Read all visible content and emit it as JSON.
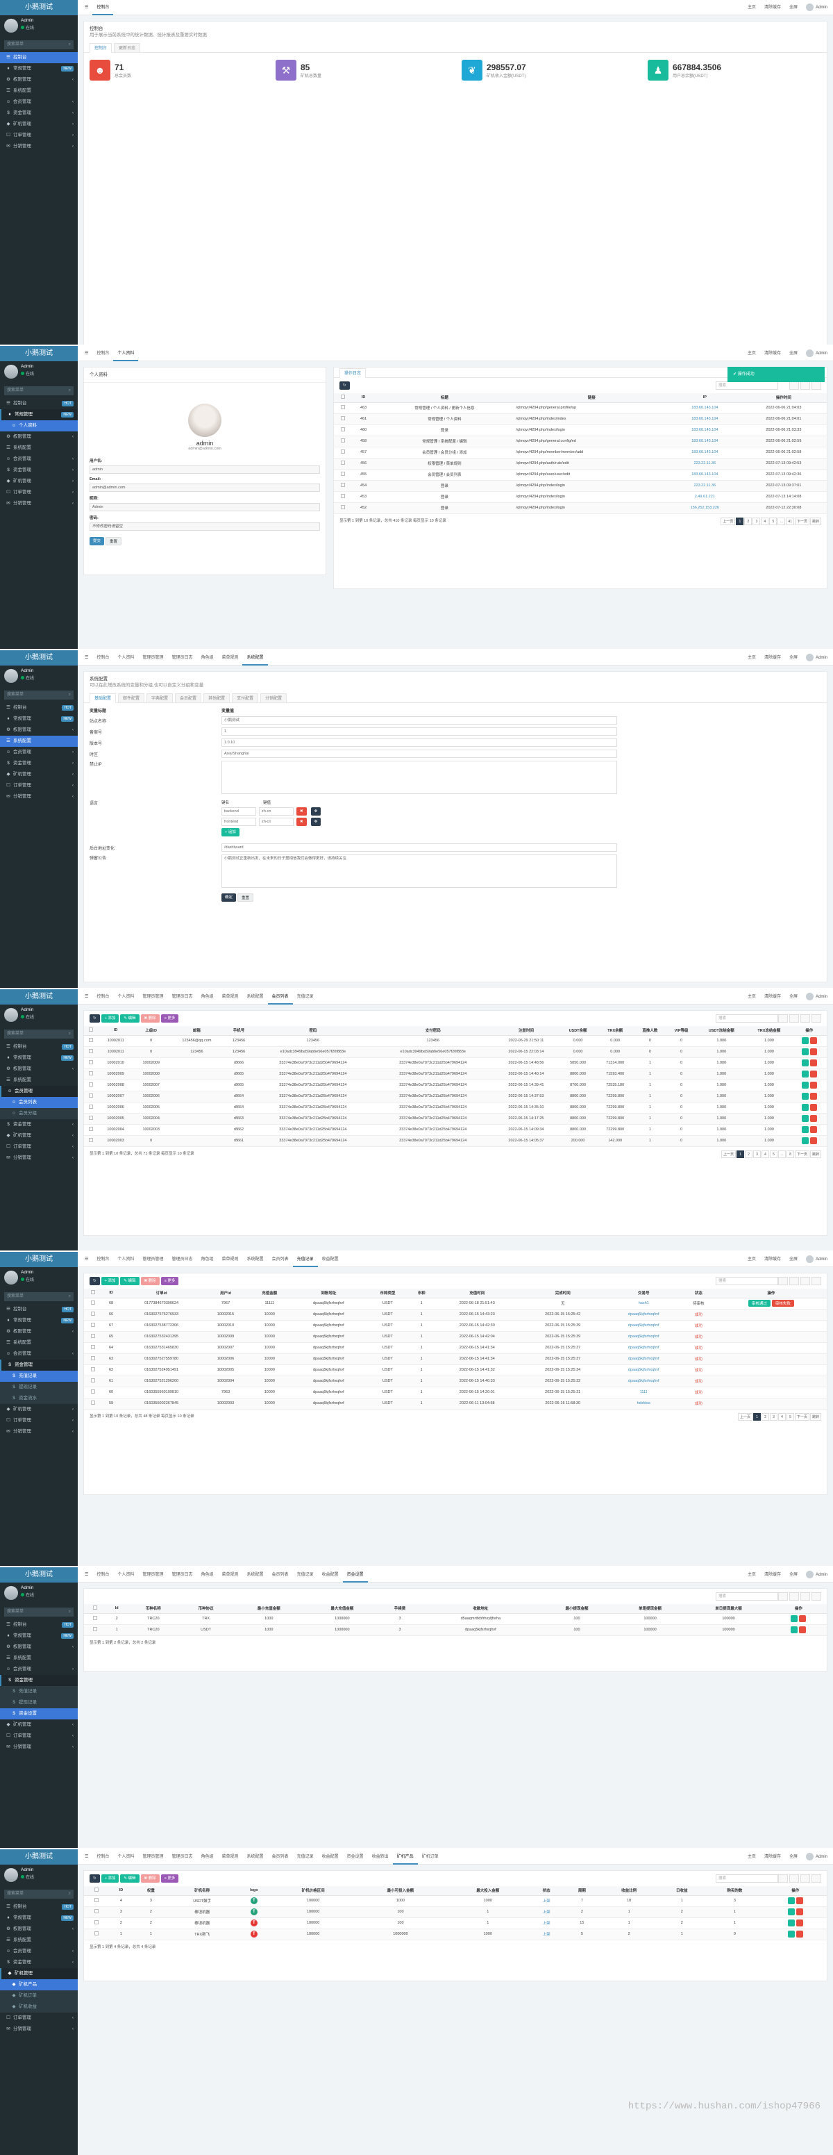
{
  "app": {
    "brand": "小鹅测试",
    "user": "Admin",
    "status": "在线",
    "search_ph": "搜索菜单",
    "admin_name": "Admin"
  },
  "top": {
    "home": "主页",
    "clear": "清除缓存",
    "fullscreen": "全屏"
  },
  "tabs": {
    "console": "控制台",
    "profile": "个人资料",
    "admin": "管理员管理",
    "logs": "管理员日志",
    "role": "角色组",
    "menu": "菜单规则",
    "config": "系统配置",
    "members": "会员列表",
    "orders": "充值记录",
    "payment": "收益配置",
    "recharge": "资金设置",
    "withdraw": "收益转出",
    "pledge": "矿机产品",
    "order2": "矿机订单"
  },
  "menu": {
    "p1": [
      {
        "ic": "☰",
        "label": "控制台",
        "act": true
      },
      {
        "ic": "♦",
        "label": "常规管理",
        "badge": "NEW"
      },
      {
        "ic": "⚙",
        "label": "权限管理",
        "ch": "‹"
      },
      {
        "ic": "☰",
        "label": "系统配置"
      },
      {
        "ic": "☺",
        "label": "会员管理",
        "ch": "‹"
      },
      {
        "ic": "$",
        "label": "资金管理",
        "ch": "‹"
      },
      {
        "ic": "◆",
        "label": "矿机管理",
        "ch": "‹"
      },
      {
        "ic": "☐",
        "label": "订单管理",
        "ch": "‹"
      },
      {
        "ic": "✉",
        "label": "分销管理",
        "ch": "‹"
      }
    ],
    "p2": [
      {
        "ic": "☰",
        "label": "控制台",
        "badge": "HOT"
      },
      {
        "ic": "♦",
        "label": "常规管理",
        "badge": "NEW",
        "open": true
      },
      {
        "ic": "☺",
        "label": "个人资料",
        "subact": true
      },
      {
        "ic": "⚙",
        "label": "权限管理",
        "ch": "‹"
      },
      {
        "ic": "☰",
        "label": "系统配置"
      },
      {
        "ic": "☺",
        "label": "会员管理",
        "ch": "‹"
      },
      {
        "ic": "$",
        "label": "资金管理",
        "ch": "‹"
      },
      {
        "ic": "◆",
        "label": "矿机管理",
        "ch": "‹"
      },
      {
        "ic": "☐",
        "label": "订单管理",
        "ch": "‹"
      },
      {
        "ic": "✉",
        "label": "分销管理",
        "ch": "‹"
      }
    ],
    "p3": [
      {
        "ic": "☰",
        "label": "控制台",
        "badge": "HOT"
      },
      {
        "ic": "♦",
        "label": "常规管理",
        "badge": "NEW"
      },
      {
        "ic": "⚙",
        "label": "权限管理",
        "ch": "‹"
      },
      {
        "ic": "☰",
        "label": "系统配置",
        "act": true
      },
      {
        "ic": "☺",
        "label": "会员管理",
        "ch": "‹"
      },
      {
        "ic": "$",
        "label": "资金管理",
        "ch": "‹"
      },
      {
        "ic": "◆",
        "label": "矿机管理",
        "ch": "‹"
      },
      {
        "ic": "☐",
        "label": "订单管理",
        "ch": "‹"
      },
      {
        "ic": "✉",
        "label": "分销管理",
        "ch": "‹"
      }
    ],
    "p4": [
      {
        "ic": "☰",
        "label": "控制台",
        "badge": "HOT"
      },
      {
        "ic": "♦",
        "label": "常规管理",
        "badge": "NEW"
      },
      {
        "ic": "⚙",
        "label": "权限管理",
        "ch": "‹"
      },
      {
        "ic": "☰",
        "label": "系统配置"
      },
      {
        "ic": "☺",
        "label": "会员管理",
        "open": true
      },
      {
        "ic": "☺",
        "label": "会员列表",
        "subact": true
      },
      {
        "ic": "☺",
        "label": "会员分组",
        "sub": true
      },
      {
        "ic": "$",
        "label": "资金管理",
        "ch": "‹"
      },
      {
        "ic": "◆",
        "label": "矿机管理",
        "ch": "‹"
      },
      {
        "ic": "☐",
        "label": "订单管理",
        "ch": "‹"
      },
      {
        "ic": "✉",
        "label": "分销管理",
        "ch": "‹"
      }
    ],
    "p5": [
      {
        "ic": "☰",
        "label": "控制台",
        "badge": "HOT"
      },
      {
        "ic": "♦",
        "label": "常规管理",
        "badge": "NEW"
      },
      {
        "ic": "⚙",
        "label": "权限管理",
        "ch": "‹"
      },
      {
        "ic": "☰",
        "label": "系统配置"
      },
      {
        "ic": "☺",
        "label": "会员管理",
        "ch": "‹"
      },
      {
        "ic": "$",
        "label": "资金管理",
        "open": true
      },
      {
        "ic": "$",
        "label": "充值记录",
        "subact": true
      },
      {
        "ic": "$",
        "label": "提现记录",
        "sub": true
      },
      {
        "ic": "$",
        "label": "资金流水",
        "sub": true
      },
      {
        "ic": "◆",
        "label": "矿机管理",
        "ch": "‹"
      },
      {
        "ic": "☐",
        "label": "订单管理",
        "ch": "‹"
      },
      {
        "ic": "✉",
        "label": "分销管理",
        "ch": "‹"
      }
    ],
    "p6": [
      {
        "ic": "☰",
        "label": "控制台",
        "badge": "HOT"
      },
      {
        "ic": "♦",
        "label": "常规管理",
        "badge": "NEW"
      },
      {
        "ic": "⚙",
        "label": "权限管理",
        "ch": "‹"
      },
      {
        "ic": "☰",
        "label": "系统配置"
      },
      {
        "ic": "☺",
        "label": "会员管理",
        "ch": "‹"
      },
      {
        "ic": "$",
        "label": "资金管理",
        "open": true
      },
      {
        "ic": "$",
        "label": "充值记录",
        "sub": true
      },
      {
        "ic": "$",
        "label": "提现记录",
        "sub": true
      },
      {
        "ic": "$",
        "label": "资金设置",
        "subact": true
      },
      {
        "ic": "◆",
        "label": "矿机管理",
        "ch": "‹"
      },
      {
        "ic": "☐",
        "label": "订单管理",
        "ch": "‹"
      },
      {
        "ic": "✉",
        "label": "分销管理",
        "ch": "‹"
      }
    ],
    "p7": [
      {
        "ic": "☰",
        "label": "控制台",
        "badge": "HOT"
      },
      {
        "ic": "♦",
        "label": "常规管理",
        "badge": "NEW"
      },
      {
        "ic": "⚙",
        "label": "权限管理",
        "ch": "‹"
      },
      {
        "ic": "☰",
        "label": "系统配置"
      },
      {
        "ic": "☺",
        "label": "会员管理",
        "ch": "‹"
      },
      {
        "ic": "$",
        "label": "资金管理",
        "ch": "‹"
      },
      {
        "ic": "◆",
        "label": "矿机管理",
        "open": true
      },
      {
        "ic": "◆",
        "label": "矿机产品",
        "subact": true
      },
      {
        "ic": "◆",
        "label": "矿机订单",
        "sub": true
      },
      {
        "ic": "◆",
        "label": "矿机收益",
        "sub": true
      },
      {
        "ic": "☐",
        "label": "订单管理",
        "ch": "‹"
      },
      {
        "ic": "✉",
        "label": "分销管理",
        "ch": "‹"
      }
    ]
  },
  "dash": {
    "title": "控制台",
    "sub": "用于展示当前系统中的统计数据、统计报表及重要实时数据",
    "tab1": "控制台",
    "tab2": "更新日志",
    "stats": [
      {
        "icon": "☻",
        "num": "71",
        "label": "总会员数",
        "color": "#e74c3c"
      },
      {
        "icon": "⚒",
        "num": "85",
        "label": "矿机总数量",
        "color": "#8e6fc9"
      },
      {
        "icon": "❦",
        "num": "298557.07",
        "label": "矿机收入金额(USDT)",
        "color": "#1fa7d5"
      },
      {
        "icon": "♟",
        "num": "667884.3506",
        "label": "用户总余额(USDT)",
        "color": "#18bc9c"
      }
    ]
  },
  "profile": {
    "box_title": "个人资料",
    "name": "admin",
    "email": "admin@admin.com",
    "fields": [
      {
        "label": "用户名:",
        "value": "admin"
      },
      {
        "label": "Email:",
        "value": "admin@admin.com"
      },
      {
        "label": "昵称:",
        "value": "Admin"
      },
      {
        "label": "密码:",
        "value": "不修改密码请留空"
      }
    ],
    "submit": "提交",
    "reset": "重置",
    "log_title": "操作日志",
    "toast": "操作成功",
    "log_cols": [
      "ID",
      "标题",
      "链接",
      "IP",
      "操作时间"
    ],
    "log_rows": [
      [
        "463",
        "常规管理 / 个人资料 / 更新个人信息",
        "/qlmqvr/4294.php/general.profile/up",
        "183.60.143.104",
        "2022-06-06 21:04:03"
      ],
      [
        "461",
        "常规管理 / 个人资料",
        "/qlmqvr/4294.php/index/index",
        "183.60.143.104",
        "2022-06-06 21:04:01"
      ],
      [
        "460",
        "登录",
        "/qlmqvr/4294.php/index/login",
        "183.60.143.104",
        "2022-06-06 21:03:33"
      ],
      [
        "458",
        "常规管理 / 系统配置 / 编辑",
        "/qlmqvr/4294.php/general.config/ed",
        "183.60.143.104",
        "2022-06-06 21:02:59"
      ],
      [
        "457",
        "会员管理 / 会员分组 / 添加",
        "/qlmqvr/4294.php/member/member/add",
        "183.60.143.104",
        "2022-06-06 21:02:58"
      ],
      [
        "456",
        "权限管理 / 菜单规则",
        "/qlmqvr/4294.php/auth/rule/edit",
        "223.22.11.36",
        "2022-07-13 09:42:53"
      ],
      [
        "455",
        "会员管理 / 会员列表",
        "/qlmqvr/4294.php/user/user/edit",
        "183.60.143.104",
        "2022-07-13 09:42:36"
      ],
      [
        "454",
        "登录",
        "/qlmqvr/4294.php/index/login",
        "223.22.11.36",
        "2022-07-13 09:37:01"
      ],
      [
        "453",
        "登录",
        "/qlmqvr/4294.php/index/login",
        "2.49.61.221",
        "2022-07-13 14:14:08"
      ],
      [
        "452",
        "登录",
        "/qlmqvr/4294.php/index/login",
        "156.252.153.226",
        "2022-07-12 22:30:08"
      ]
    ],
    "pager": "显示第 1 到第 10 条记录，总共 410 条记录 每页显示 10 条记录",
    "pages": [
      "上一页",
      "1",
      "2",
      "3",
      "4",
      "5",
      "...",
      "41",
      "下一页"
    ],
    "goto": "跳转"
  },
  "config": {
    "title": "系统配置",
    "sub": "可以在此增改系统的变量和分组,也可以自定义分组和变量",
    "tabs": [
      "基础配置",
      "邮件配置",
      "字典配置",
      "会员配置",
      "其他配置",
      "支付配置",
      "分销配置"
    ],
    "col1": "变量标题",
    "col2": "变量值",
    "rows": [
      {
        "label": "站点名称",
        "value": "小鹅测试"
      },
      {
        "label": "备案号",
        "value": "1"
      },
      {
        "label": "版本号",
        "value": "1.0.10"
      },
      {
        "label": "时区",
        "value": "Asia/Shanghai"
      },
      {
        "label": "禁止IP",
        "value": ""
      }
    ],
    "lang_label": "语言",
    "lang_head1": "键名",
    "lang_head2": "键值",
    "langs": [
      {
        "k": "backend",
        "v": "zh-cn"
      },
      {
        "k": "frontend",
        "v": "zh-cn"
      }
    ],
    "append": "追加",
    "addr_label": "后台地址变化",
    "addr_value": "/dashboard",
    "notice_label": "弹窗公告",
    "notice_value": "小鹅测试正重新出发，在未来的日子里相信我们会做得更好，请持续关注",
    "ok": "确定",
    "reset": "重置"
  },
  "members": {
    "cols": [
      "ID",
      "上级ID",
      "邮箱",
      "手机号",
      "密码",
      "支付密码",
      "注册时间",
      "USDT余额",
      "TRX余额",
      "直推人数",
      "VIP等级",
      "USDT冻结金额",
      "TRX冻结金额",
      "操作"
    ],
    "rows": [
      [
        "10002011",
        "0",
        "123456@qq.com",
        "123456",
        "123456",
        "123456",
        "2022-06-29 21:50:11",
        "0.000",
        "0.000",
        "0",
        "0",
        "1.000",
        "1.000"
      ],
      [
        "10002011",
        "0",
        "123456",
        "123456",
        "e10adc3949ba59abbe56e057f20f883e",
        "e10adc3949ba59abbe56e057f20f883e",
        "2022-06-15 22:03:14",
        "0.000",
        "0.000",
        "0",
        "0",
        "1.000",
        "1.000"
      ],
      [
        "10002010",
        "10002009",
        "",
        "r8666",
        "33374e38e0a7073c211d25b479694124",
        "33374e38e0a7073c211d25b479694124",
        "2022-06-15 14:48:56",
        "5850.000",
        "71314.000",
        "1",
        "0",
        "1.000",
        "1.000"
      ],
      [
        "10002009",
        "10002008",
        "",
        "r8665",
        "33374e38e0a7073c211d25b479694124",
        "33374e38e0a7073c211d25b479694124",
        "2022-06-15 14:40:14",
        "8800.000",
        "71593.400",
        "1",
        "0",
        "1.000",
        "1.000"
      ],
      [
        "10002008",
        "10002007",
        "",
        "r8665",
        "33374e38e0a7073c211d25b479694124",
        "33374e38e0a7073c211d25b479694124",
        "2022-06-15 14:39:41",
        "8700.000",
        "72535.180",
        "1",
        "0",
        "1.000",
        "1.000"
      ],
      [
        "10002007",
        "10002006",
        "",
        "r8664",
        "33374e38e0a7073c211d25b479694124",
        "33374e38e0a7073c211d25b479694124",
        "2022-06-15 14:37:53",
        "8800.000",
        "72299.800",
        "1",
        "0",
        "1.000",
        "1.000"
      ],
      [
        "10002006",
        "10002005",
        "",
        "r8664",
        "33374e38e0a7073c211d25b479694124",
        "33374e38e0a7073c211d25b479694124",
        "2022-06-15 14:35:10",
        "8800.000",
        "72299.800",
        "1",
        "0",
        "1.000",
        "1.000"
      ],
      [
        "10002005",
        "10002004",
        "",
        "r8663",
        "33374e38e0a7073c211d25b479694124",
        "33374e38e0a7073c211d25b479694124",
        "2022-06-15 14:17:25",
        "8800.000",
        "72299.800",
        "1",
        "0",
        "1.000",
        "1.000"
      ],
      [
        "10002004",
        "10002003",
        "",
        "r8662",
        "33374e38e0a7073c211d25b479694124",
        "33374e38e0a7073c211d25b479694124",
        "2022-06-15 14:09:34",
        "8800.000",
        "72299.800",
        "1",
        "0",
        "1.000",
        "1.000"
      ],
      [
        "10002003",
        "0",
        "",
        "r8661",
        "33374e38e0a7073c211d25b479694124",
        "33374e38e0a7073c211d25b479694124",
        "2022-06-15 14:05:37",
        "200.000",
        "142.000",
        "1",
        "0",
        "1.000",
        "1.000"
      ]
    ],
    "pager": "显示第 1 到第 10 条记录，总共 71 条记录 每页显示 10 条记录",
    "pages": [
      "上一页",
      "1",
      "2",
      "3",
      "4",
      "5",
      "...",
      "8",
      "下一页"
    ],
    "goto": "跳转"
  },
  "recharge": {
    "cols": [
      "ID",
      "订单id",
      "用户id",
      "充值金额",
      "到账地址",
      "币种类型",
      "币种",
      "充值时间",
      "完成时间",
      "交易号",
      "状态",
      "操作"
    ],
    "rows": [
      [
        "68",
        "0177384670390624",
        "7967",
        "11111",
        "dpaaq5kjfsrhxqhvf",
        "USDT",
        "1",
        "2022-06-18 21:51:43",
        "无",
        "hash1",
        "待审核"
      ],
      [
        "66",
        "0163027576276933",
        "10002015",
        "10000",
        "dpaaq5kjfsrhxqhvf",
        "USDT",
        "1",
        "2022-06-15 14:43:23",
        "2022-06-15 15:25:42",
        "dpaaq5kjfsrhxqhvf",
        "成功"
      ],
      [
        "67",
        "0163027538772306",
        "10002010",
        "10000",
        "dpaaq5kjfsrhxqhvf",
        "USDT",
        "1",
        "2022-06-15 14:42:30",
        "2022-06-15 15:25:39",
        "dpaaq5kjfsrhxqhvf",
        "成功"
      ],
      [
        "65",
        "0163027532431395",
        "10002009",
        "10000",
        "dpaaq5kjfsrhxqhvf",
        "USDT",
        "1",
        "2022-06-15 14:42:04",
        "2022-06-15 15:25:39",
        "dpaaq5kjfsrhxqhvf",
        "成功"
      ],
      [
        "64",
        "0163027531465830",
        "10002007",
        "10000",
        "dpaaq5kjfsrhxqhvf",
        "USDT",
        "1",
        "2022-06-15 14:41:34",
        "2022-06-15 15:25:37",
        "dpaaq5kjfsrhxqhvf",
        "成功"
      ],
      [
        "63",
        "0163027527559780",
        "10002006",
        "10000",
        "dpaaq5kjfsrhxqhvf",
        "USDT",
        "1",
        "2022-06-15 14:41:34",
        "2022-06-15 15:25:37",
        "dpaaq5kjfsrhxqhvf",
        "成功"
      ],
      [
        "62",
        "0163027524951491",
        "10002005",
        "10000",
        "dpaaq5kjfsrhxqhvf",
        "USDT",
        "1",
        "2022-06-15 14:41:32",
        "2022-06-15 15:25:34",
        "dpaaq5kjfsrhxqhvf",
        "成功"
      ],
      [
        "61",
        "0163027521296200",
        "10002004",
        "10000",
        "dpaaq5kjfsrhxqhvf",
        "USDT",
        "1",
        "2022-06-15 14:40:33",
        "2022-06-15 15:25:32",
        "dpaaq5kjfsrhxqhvf",
        "成功"
      ],
      [
        "60",
        "0160355960109810",
        "7963",
        "10000",
        "dpaaq5kjfsrhxqhvf",
        "USDT",
        "1",
        "2022-06-15 14:20:01",
        "2022-06-15 15:25:31",
        "1111",
        "成功"
      ],
      [
        "59",
        "0160355002267845",
        "10002003",
        "10000",
        "dpaaq5kjfsrhxqhvf",
        "USDT",
        "1",
        "2022-06-11 13:04:58",
        "2022-06-15 11:58:30",
        "hdsfdsa",
        "成功"
      ]
    ],
    "approve": "审核通过",
    "reject": "审核失败",
    "pager": "显示第 1 到第 10 条记录，总共 48 条记录 每页显示 10 条记录",
    "pages": [
      "上一页",
      "1",
      "2",
      "3",
      "4",
      "5",
      "下一页"
    ],
    "goto": "跳转"
  },
  "fundset": {
    "cols": [
      "Id",
      "币种名称",
      "币种协议",
      "最小充值金额",
      "最大充值金额",
      "手续费",
      "收款地址",
      "最小提现金额",
      "单笔提现金额",
      "单日提现最大额",
      "操作"
    ],
    "rows": [
      [
        "2",
        "TRC20",
        "TRX",
        "1000",
        "1000000",
        "3",
        "d5aaqmrtfxbfrhxyfjfsrha",
        "100",
        "100000",
        "100000"
      ],
      [
        "1",
        "TRC20",
        "USDT",
        "1000",
        "1000000",
        "3",
        "dpaaq5kjfsrhxqhvf",
        "100",
        "100000",
        "100000"
      ]
    ],
    "pager": "显示第 1 到第 2 条记录，总共 2 条记录"
  },
  "products": {
    "cols": [
      "ID",
      "权重",
      "矿机名称",
      "logo",
      "矿机价格区间",
      "最小可投入金额",
      "最大投入金额",
      "状态",
      "周期",
      "收益比例",
      "日收益",
      "购买的数",
      "操作"
    ],
    "rows": [
      {
        "id": "4",
        "w": "3",
        "name": "USDT鼓手",
        "logo": "T",
        "lc": "#26a17b",
        "range": "100000",
        "min": "1000",
        "max": "1000",
        "st": "上架",
        "cyc": "7",
        "rate": "18",
        "day": "1",
        "cnt": "3"
      },
      {
        "id": "3",
        "w": "2",
        "name": "泰坦机器",
        "logo": "T",
        "lc": "#26a17b",
        "range": "100000",
        "min": "100",
        "max": "1",
        "st": "上架",
        "cyc": "2",
        "rate": "1",
        "day": "2",
        "cnt": "1"
      },
      {
        "id": "2",
        "w": "2",
        "name": "泰坦机器",
        "logo": "T",
        "lc": "#e53935",
        "range": "100000",
        "min": "100",
        "max": "1",
        "st": "上架",
        "cyc": "15",
        "rate": "1",
        "day": "2",
        "cnt": "1"
      },
      {
        "id": "1",
        "w": "1",
        "name": "TRX新飞",
        "logo": "T",
        "lc": "#e53935",
        "range": "100000",
        "min": "1000000",
        "max": "1000",
        "st": "上架",
        "cyc": "5",
        "rate": "2",
        "day": "1",
        "cnt": "0"
      }
    ],
    "pager": "显示第 1 到第 4 条记录，总共 4 条记录"
  },
  "toolbar": {
    "refresh": "↻",
    "add": "+ 添加",
    "edit": "✎ 编辑",
    "del": "✖ 删除",
    "more": "≡ 更多",
    "search_ph": "搜索"
  },
  "watermark": "https://www.hushan.com/ishop47966"
}
